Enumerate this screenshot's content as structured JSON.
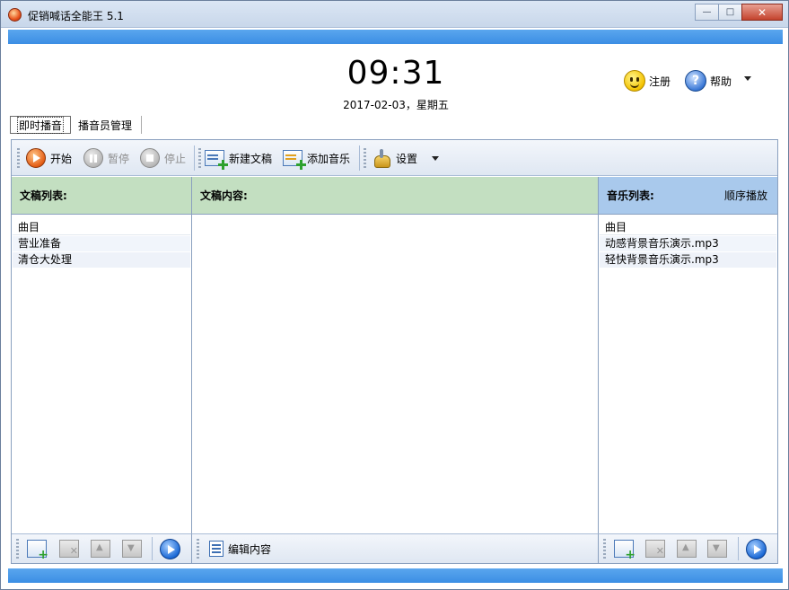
{
  "window": {
    "title": "促销喊话全能王 5.1",
    "controls": {
      "minimize": "—",
      "maximize": "□",
      "close": "✕"
    }
  },
  "clock": {
    "time": "09:31",
    "date": "2017-02-03，星期五"
  },
  "header_links": {
    "register": "注册",
    "help": "帮助"
  },
  "tabs": [
    {
      "label": "即时播音",
      "active": true
    },
    {
      "label": "播音员管理",
      "active": false
    }
  ],
  "toolbar": {
    "start": "开始",
    "pause": "暂停",
    "stop": "停止",
    "new_doc": "新建文稿",
    "add_music": "添加音乐",
    "settings": "设置"
  },
  "doc_list": {
    "title": "文稿列表:",
    "column": "曲目",
    "items": [
      "营业准备",
      "清仓大处理"
    ]
  },
  "doc_content": {
    "title": "文稿内容:"
  },
  "music_list": {
    "title": "音乐列表:",
    "mode": "顺序播放",
    "column": "曲目",
    "items": [
      "动感背景音乐演示.mp3",
      "轻快背景音乐演示.mp3"
    ]
  },
  "bottom": {
    "edit_content": "编辑内容"
  },
  "colors": {
    "title_bar": "#c8d7ea",
    "blue_band": "#3b8ee4",
    "doc_header": "#c3dfc1",
    "music_header": "#a9c9ec",
    "play_accent": "#e45d15"
  },
  "icons": [
    "app-icon",
    "smiley-icon",
    "help-icon",
    "play-icon",
    "pause-icon",
    "stop-icon",
    "new-doc-icon",
    "add-music-icon",
    "settings-icon",
    "add-icon",
    "delete-icon",
    "move-up-icon",
    "move-down-icon",
    "edit-icon"
  ]
}
